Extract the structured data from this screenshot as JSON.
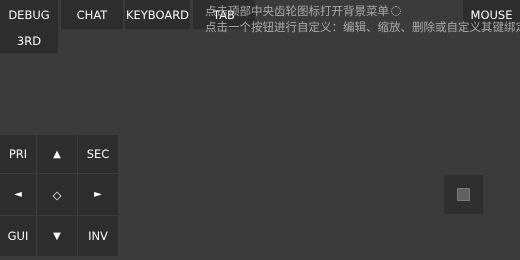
{
  "top_bar": {
    "debug": "DEBUG",
    "chat": "CHAT",
    "keyboard": "KEYBOARD",
    "tab": "TAB",
    "mouse": "MOUSE",
    "third_person": "3RD"
  },
  "hint": {
    "line1": "点击顶部中央齿轮图标打开背景菜单",
    "line2": "点击一个按钮进行自定义：编辑、缩放、删除或自定义其键绑定。",
    "gear_icon": "gear-icon"
  },
  "dpad": {
    "primary": "PRI",
    "up": "▲",
    "secondary": "SEC",
    "left": "◄",
    "center": "◇",
    "right": "►",
    "gui": "GUI",
    "down": "▼",
    "inventory": "INV"
  },
  "mouse_pad": {
    "icon": "square-stick-icon"
  },
  "colors": {
    "background": "#3b3b3b",
    "button": "#2d2d2d",
    "text": "#ffffff",
    "hint_text": "#a9a9a9"
  }
}
